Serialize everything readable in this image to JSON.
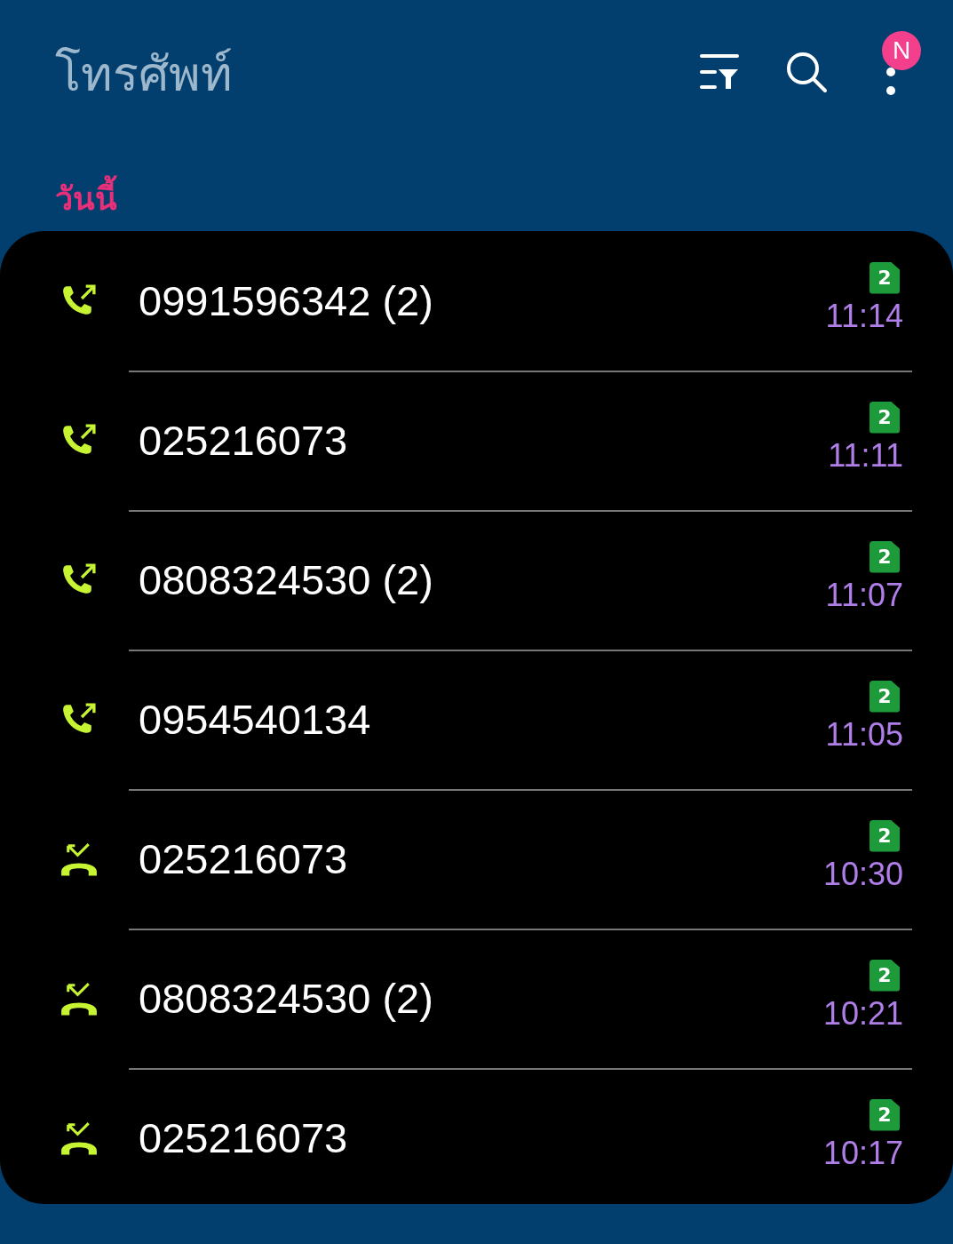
{
  "header": {
    "title": "โทรศัพท์",
    "badge": "N"
  },
  "section": "วันนี้",
  "calls": [
    {
      "kind": "outgoing",
      "number": "0991596342 (2)",
      "sim": "2",
      "time": "11:14"
    },
    {
      "kind": "outgoing",
      "number": "025216073",
      "sim": "2",
      "time": "11:11"
    },
    {
      "kind": "outgoing",
      "number": "0808324530 (2)",
      "sim": "2",
      "time": "11:07"
    },
    {
      "kind": "outgoing",
      "number": "0954540134",
      "sim": "2",
      "time": "11:05"
    },
    {
      "kind": "missed",
      "number": "025216073",
      "sim": "2",
      "time": "10:30"
    },
    {
      "kind": "missed",
      "number": "0808324530 (2)",
      "sim": "2",
      "time": "10:21"
    },
    {
      "kind": "missed",
      "number": "025216073",
      "sim": "2",
      "time": "10:17"
    }
  ]
}
